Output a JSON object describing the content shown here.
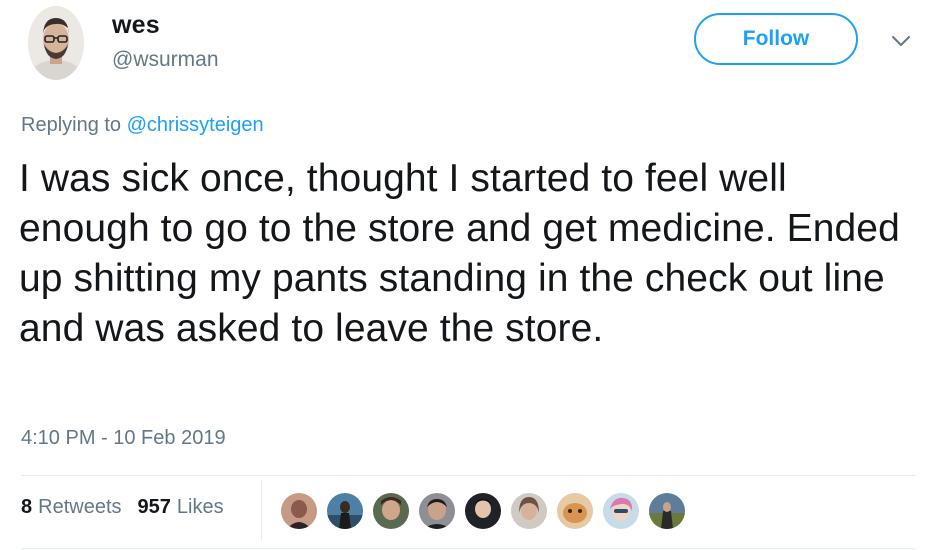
{
  "user": {
    "name": "wes",
    "handle": "@wsurman"
  },
  "follow_button": {
    "label": "Follow"
  },
  "menu": {
    "icon": "chevron-down-icon"
  },
  "reply": {
    "prefix": "Replying to",
    "mention": "@chrissyteigen"
  },
  "tweet": {
    "text": "I was sick once, thought I started to feel well enough to go to the store and get medicine. Ended up shitting my pants standing in the check out line and was asked to leave the store.",
    "timestamp": "4:10 PM - 10 Feb 2019"
  },
  "stats": {
    "retweets_count": "8",
    "retweets_label": "Retweets",
    "likes_count": "957",
    "likes_label": "Likes"
  },
  "colors": {
    "accent": "#1da1f2",
    "text": "#14171a",
    "muted": "#657786",
    "divider": "#e6ecf0"
  },
  "likers": [
    {
      "name": "liker-avatar-1"
    },
    {
      "name": "liker-avatar-2"
    },
    {
      "name": "liker-avatar-3"
    },
    {
      "name": "liker-avatar-4"
    },
    {
      "name": "liker-avatar-5"
    },
    {
      "name": "liker-avatar-6"
    },
    {
      "name": "liker-avatar-7"
    },
    {
      "name": "liker-avatar-8"
    },
    {
      "name": "liker-avatar-9"
    }
  ]
}
